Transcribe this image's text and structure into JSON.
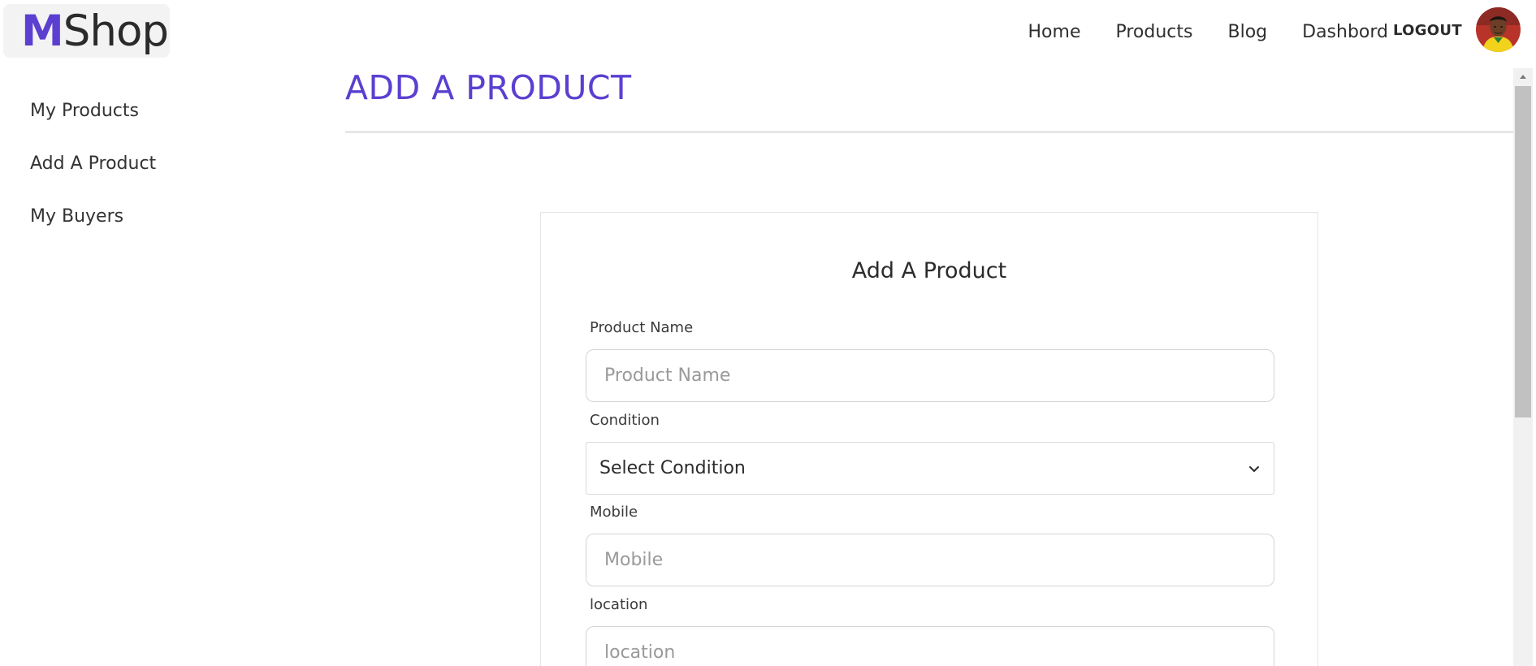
{
  "brand": {
    "initial": "M",
    "rest": "Shop",
    "accent_color": "#5b3fd0"
  },
  "topnav": {
    "items": [
      "Home",
      "Products",
      "Blog",
      "Dashbord"
    ],
    "logout": "LOGOUT"
  },
  "sidebar": {
    "items": [
      "My Products",
      "Add A Product",
      "My Buyers"
    ]
  },
  "page": {
    "title": "ADD A PRODUCT"
  },
  "form": {
    "title": "Add A Product",
    "product_name": {
      "label": "Product Name",
      "placeholder": "Product Name",
      "value": ""
    },
    "condition": {
      "label": "Condition",
      "selected": "Select Condition"
    },
    "mobile": {
      "label": "Mobile",
      "placeholder": "Mobile",
      "value": ""
    },
    "location": {
      "label": "location",
      "placeholder": "location",
      "value": ""
    }
  }
}
